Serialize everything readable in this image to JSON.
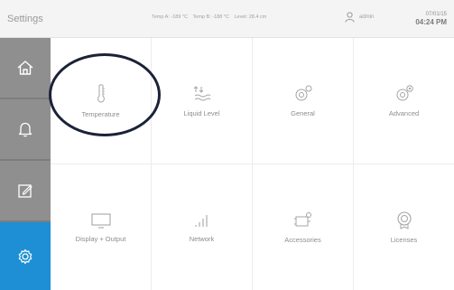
{
  "header": {
    "title": "Settings",
    "temp_a": "Temp A: -189 °C",
    "temp_b": "Temp B: -188 °C",
    "level": "Level: 28.4 cm",
    "user": "admin",
    "date": "07/01/15",
    "time": "04:24 PM"
  },
  "sidebar": {
    "items": [
      {
        "icon": "home-icon",
        "active": false
      },
      {
        "icon": "bell-icon",
        "active": false
      },
      {
        "icon": "edit-icon",
        "active": false
      },
      {
        "icon": "gear-icon",
        "active": true
      }
    ]
  },
  "tiles": [
    {
      "label": "Temperature",
      "icon": "thermometer-icon"
    },
    {
      "label": "Liquid Level",
      "icon": "liquid-level-icon"
    },
    {
      "label": "General",
      "icon": "general-settings-icon"
    },
    {
      "label": "Advanced",
      "icon": "advanced-settings-icon"
    },
    {
      "label": "Display + Output",
      "icon": "display-icon"
    },
    {
      "label": "Network",
      "icon": "network-icon"
    },
    {
      "label": "Accessories",
      "icon": "accessories-icon"
    },
    {
      "label": "Licenses",
      "icon": "licenses-icon"
    }
  ],
  "colors": {
    "sidebar_gray": "#8f8f8f",
    "active_blue": "#1e8fd4",
    "highlight_ring": "#1b2238"
  }
}
